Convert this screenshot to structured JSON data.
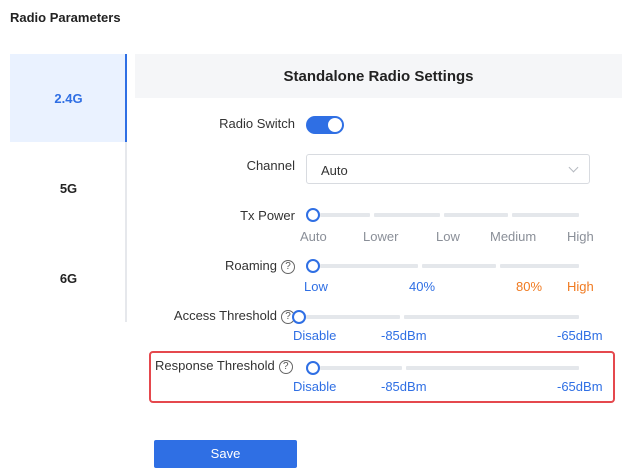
{
  "page_title": "Radio Parameters",
  "bands": [
    {
      "label": "2.4G",
      "active": true
    },
    {
      "label": "5G",
      "active": false
    },
    {
      "label": "6G",
      "active": false
    }
  ],
  "panel_title": "Standalone Radio Settings",
  "radio_switch": {
    "label": "Radio Switch",
    "on": true
  },
  "channel": {
    "label": "Channel",
    "value": "Auto"
  },
  "tx_power": {
    "label": "Tx Power",
    "ticks": [
      "Auto",
      "Lower",
      "Low",
      "Medium",
      "High"
    ],
    "selected": "Auto"
  },
  "roaming": {
    "label": "Roaming",
    "ticks": [
      "Low",
      "40%",
      "80%",
      "High"
    ],
    "selected": "Low"
  },
  "access_threshold": {
    "label": "Access Threshold",
    "ticks": [
      "Disable",
      "-85dBm",
      "-65dBm"
    ],
    "selected": "Disable"
  },
  "response_threshold": {
    "label": "Response Threshold",
    "ticks": [
      "Disable",
      "-85dBm",
      "-65dBm"
    ],
    "selected": "Disable"
  },
  "help_glyph": "?",
  "save_label": "Save",
  "colors": {
    "accent": "#2f6fe4",
    "warning": "#f07a20",
    "highlight_border": "#e5484d"
  }
}
